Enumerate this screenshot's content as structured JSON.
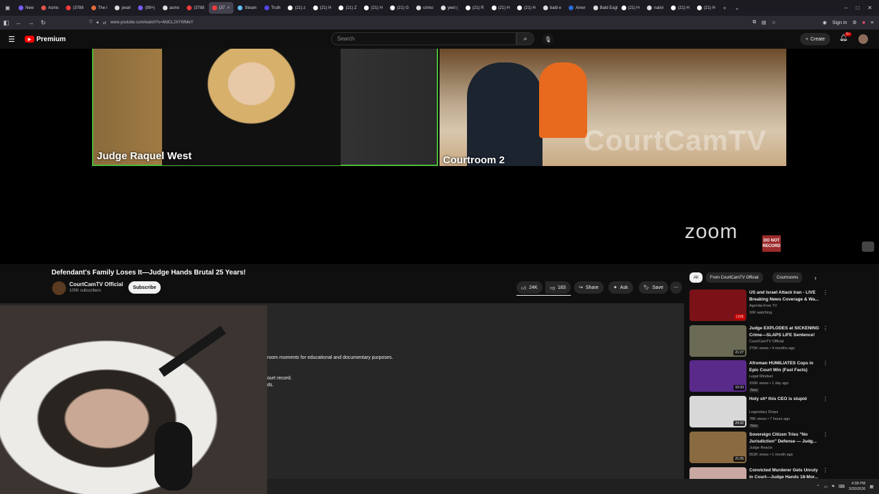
{
  "browser": {
    "tabs": [
      {
        "label": "New",
        "color": "#7a5cff"
      },
      {
        "label": "Asmo",
        "color": "#e0534a"
      },
      {
        "label": "(3788",
        "color": "#ff3b3b"
      },
      {
        "label": "The i",
        "color": "#e06a3a"
      },
      {
        "label": "pearl",
        "color": "#dddddd"
      },
      {
        "label": "(99+)",
        "color": "#7a5cff"
      },
      {
        "label": "asmo",
        "color": "#dddddd"
      },
      {
        "label": "(3788",
        "color": "#ff3b3b"
      },
      {
        "label": "(37",
        "color": "#ff3b3b",
        "active": true
      },
      {
        "label": "Steam",
        "color": "#66c0f4"
      },
      {
        "label": "Truth",
        "color": "#5448ee"
      },
      {
        "label": "(21) z",
        "color": "#ffffff"
      },
      {
        "label": "(21) H",
        "color": "#ffffff"
      },
      {
        "label": "(21) Z",
        "color": "#ffffff"
      },
      {
        "label": "(21) H",
        "color": "#ffffff"
      },
      {
        "label": "(21) G",
        "color": "#ffffff"
      },
      {
        "label": "crimo",
        "color": "#dddddd"
      },
      {
        "label": "yeet (",
        "color": "#dddddd"
      },
      {
        "label": "(21) R",
        "color": "#ffffff"
      },
      {
        "label": "(21) H",
        "color": "#ffffff"
      },
      {
        "label": "(21) H",
        "color": "#ffffff"
      },
      {
        "label": "bald e",
        "color": "#dddddd"
      },
      {
        "label": "Amer",
        "color": "#2a6ad8"
      },
      {
        "label": "Bald Eagle",
        "color": "#dddddd"
      },
      {
        "label": "(21) H",
        "color": "#ffffff"
      },
      {
        "label": "nativi",
        "color": "#dddddd"
      },
      {
        "label": "(21) H",
        "color": "#ffffff"
      },
      {
        "label": "(21) H",
        "color": "#ffffff"
      }
    ],
    "url": "www.youtube.com/watch?v=MdCLJXYWMeY",
    "signin": "Sign in"
  },
  "youtube": {
    "brand": "Premium",
    "search_placeholder": "Search",
    "create": "Create",
    "notif_count": "9+"
  },
  "video": {
    "judge_label": "Judge Raquel West",
    "courtroom_label": "Courtroom 2",
    "watermark": "CourtCamTV",
    "zoom_logo": "zoom",
    "dnr_text": "DO NOT RECORD",
    "title": "Defendant's Family Loses It—Judge Hands Brutal 25 Years!",
    "channel": "CourtCamTV Official",
    "subscribers": "100K subscribers",
    "subscribe": "Subscribe",
    "likes": "24K",
    "dislikes": "183",
    "like_ratio": 0.99,
    "share": "Share",
    "ask": "Ask",
    "save": "Save",
    "desc_line1": "room moments for educational and documentary purposes.",
    "desc_line2": "ourt record.",
    "desc_line3": "ds."
  },
  "chips": [
    "All",
    "From CourtCamTV Official",
    "Courtrooms"
  ],
  "recommended": [
    {
      "title": "US and Israel Attack Iran - LIVE Breaking News Coverage & Wa...",
      "channel": "Agenda-Free TV",
      "meta": "16K watching",
      "badge": "LIVE",
      "thumb": "#7a1218"
    },
    {
      "title": "Judge EXPLODES at SICKENING Crime—SLAPS LIFE Sentence!",
      "channel": "CourtCamTV Official",
      "meta": "275K views • 4 months ago",
      "badge": "21:27",
      "thumb": "#6b6b55"
    },
    {
      "title": "Afroman HUMILIATES Cops in Epic Court Win (Fast Facts)",
      "channel": "Legal Mindset",
      "meta": "156K views • 1 day ago",
      "badge": "10:33",
      "new": "New",
      "thumb": "#5a2a8a"
    },
    {
      "title": "Holy sh* this CEO is stupid",
      "channel": "Legendary Drops",
      "meta": "78K views • 7 hours ago",
      "badge": "24:32",
      "new": "New",
      "thumb": "#d8d8d8"
    },
    {
      "title": "Sovereign Citizen Tries \"No Jurisdiction\" Defense — Judg...",
      "channel": "Judge Reacts",
      "meta": "652K views • 1 month ago",
      "badge": "21:05",
      "thumb": "#8a6a40"
    },
    {
      "title": "Convicted Murderer Gets Unruly in Court—Judge Hands 18-Mor...",
      "channel": "",
      "meta": "",
      "badge": "",
      "thumb": "#c8a8a0"
    }
  ],
  "taskbar": {
    "time": "4:38 PM",
    "date": "3/20/2026"
  }
}
